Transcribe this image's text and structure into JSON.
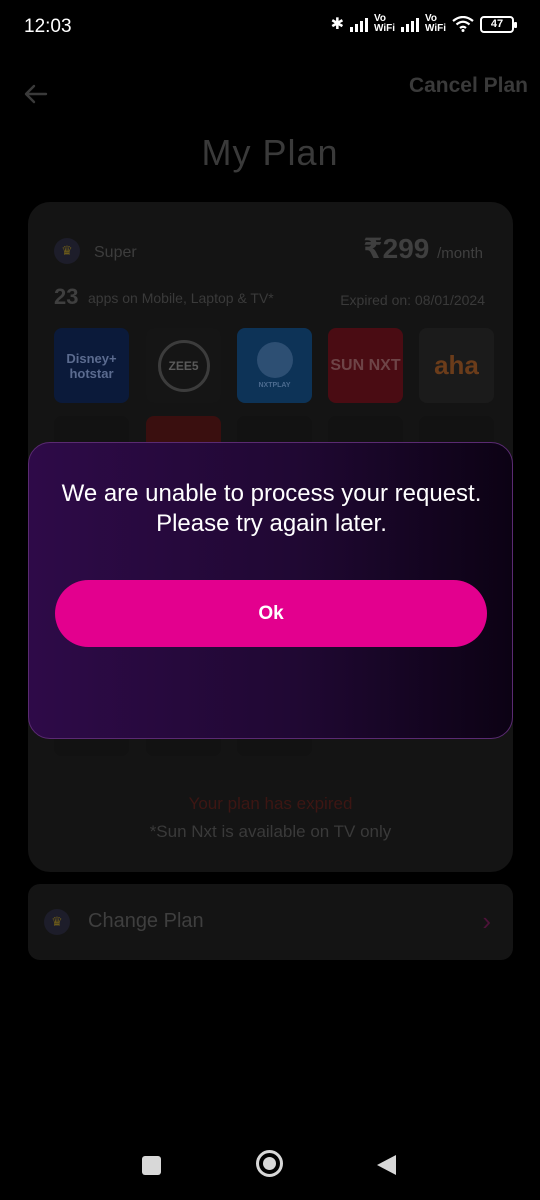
{
  "status_bar": {
    "time": "12:03",
    "vowifi_1": "Vo\nWiFi",
    "vowifi_2": "Vo\nWiFi",
    "battery": "47"
  },
  "header": {
    "back_icon": "arrow-left-icon",
    "cancel_plan": "Cancel Plan",
    "title": "My Plan"
  },
  "plan": {
    "name": "Super",
    "price": "₹299",
    "price_period": "/month",
    "apps_count": "23",
    "apps_desc": "apps on Mobile, Laptop & TV*",
    "expired_on": "Expired on: 08/01/2024",
    "apps_row1": [
      "Disney+ hotstar",
      "ZEE5",
      "NXTPLAY",
      "SUN NXT",
      "aha"
    ],
    "expired_msg": "Your plan has expired",
    "note": "*Sun Nxt is available on TV only"
  },
  "change_plan": {
    "label": "Change Plan"
  },
  "dialog": {
    "message": "We are unable to process your request. Please try again later.",
    "ok_label": "Ok"
  },
  "colors": {
    "accent": "#e3008e",
    "dialog_bg": "#2e0a48",
    "overlay": "#000000"
  }
}
